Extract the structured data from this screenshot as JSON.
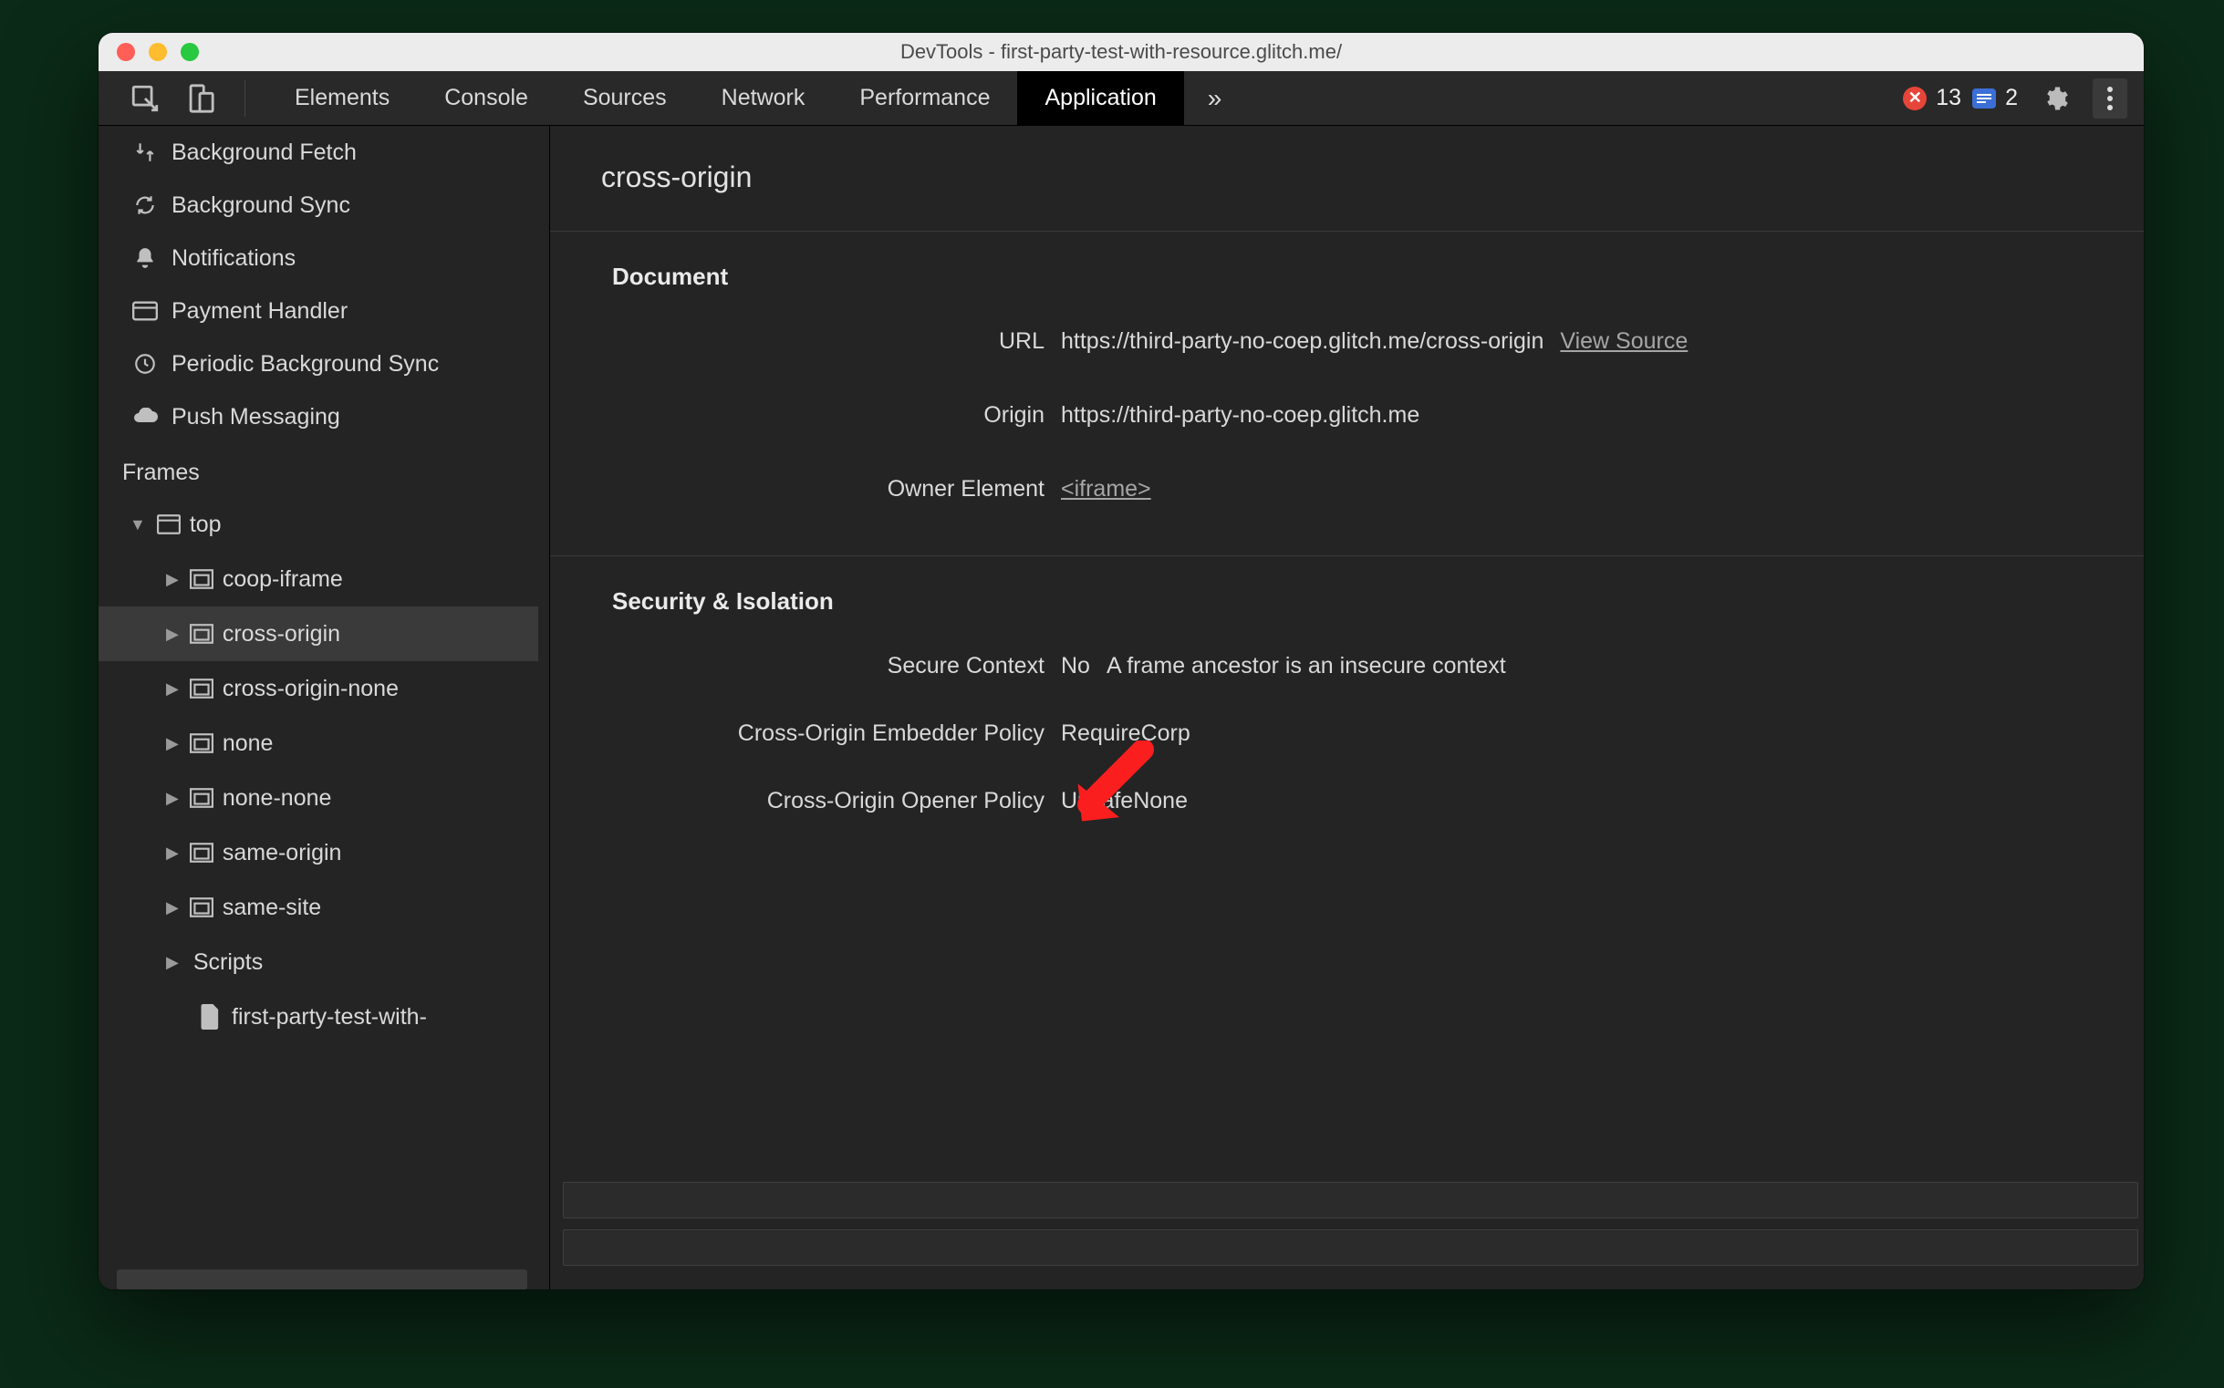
{
  "window_title": "DevTools - first-party-test-with-resource.glitch.me/",
  "tabs": {
    "items": [
      "Elements",
      "Console",
      "Sources",
      "Network",
      "Performance",
      "Application"
    ],
    "active_index": 5,
    "overflow_glyph": "»"
  },
  "toolbar": {
    "errors_count": "13",
    "messages_count": "2"
  },
  "sidebar": {
    "bgservices": [
      {
        "icon": "background-fetch",
        "label": "Background Fetch"
      },
      {
        "icon": "background-sync",
        "label": "Background Sync"
      },
      {
        "icon": "notifications",
        "label": "Notifications"
      },
      {
        "icon": "payment-handler",
        "label": "Payment Handler"
      },
      {
        "icon": "periodic-sync",
        "label": "Periodic Background Sync"
      },
      {
        "icon": "push-messaging",
        "label": "Push Messaging"
      }
    ],
    "frames_label": "Frames",
    "tree": {
      "top_label": "top",
      "children": [
        {
          "label": "coop-iframe"
        },
        {
          "label": "cross-origin",
          "selected": true
        },
        {
          "label": "cross-origin-none"
        },
        {
          "label": "none"
        },
        {
          "label": "none-none"
        },
        {
          "label": "same-origin"
        },
        {
          "label": "same-site"
        }
      ],
      "scripts_label": "Scripts",
      "script_file": "first-party-test-with-"
    }
  },
  "main": {
    "title": "cross-origin",
    "document": {
      "section_title": "Document",
      "url_label": "URL",
      "url_value": "https://third-party-no-coep.glitch.me/cross-origin",
      "view_source": "View Source",
      "origin_label": "Origin",
      "origin_value": "https://third-party-no-coep.glitch.me",
      "owner_label": "Owner Element",
      "owner_value": "<iframe>"
    },
    "security": {
      "section_title": "Security & Isolation",
      "secure_context_label": "Secure Context",
      "secure_context_value": "No",
      "secure_context_reason": "A frame ancestor is an insecure context",
      "coep_label": "Cross-Origin Embedder Policy",
      "coep_value": "RequireCorp",
      "coop_label": "Cross-Origin Opener Policy",
      "coop_value": "UnsafeNone"
    }
  },
  "annotation": {
    "type": "arrow",
    "color": "#fa1e1e",
    "points_to": "security-isolation-section-title"
  }
}
